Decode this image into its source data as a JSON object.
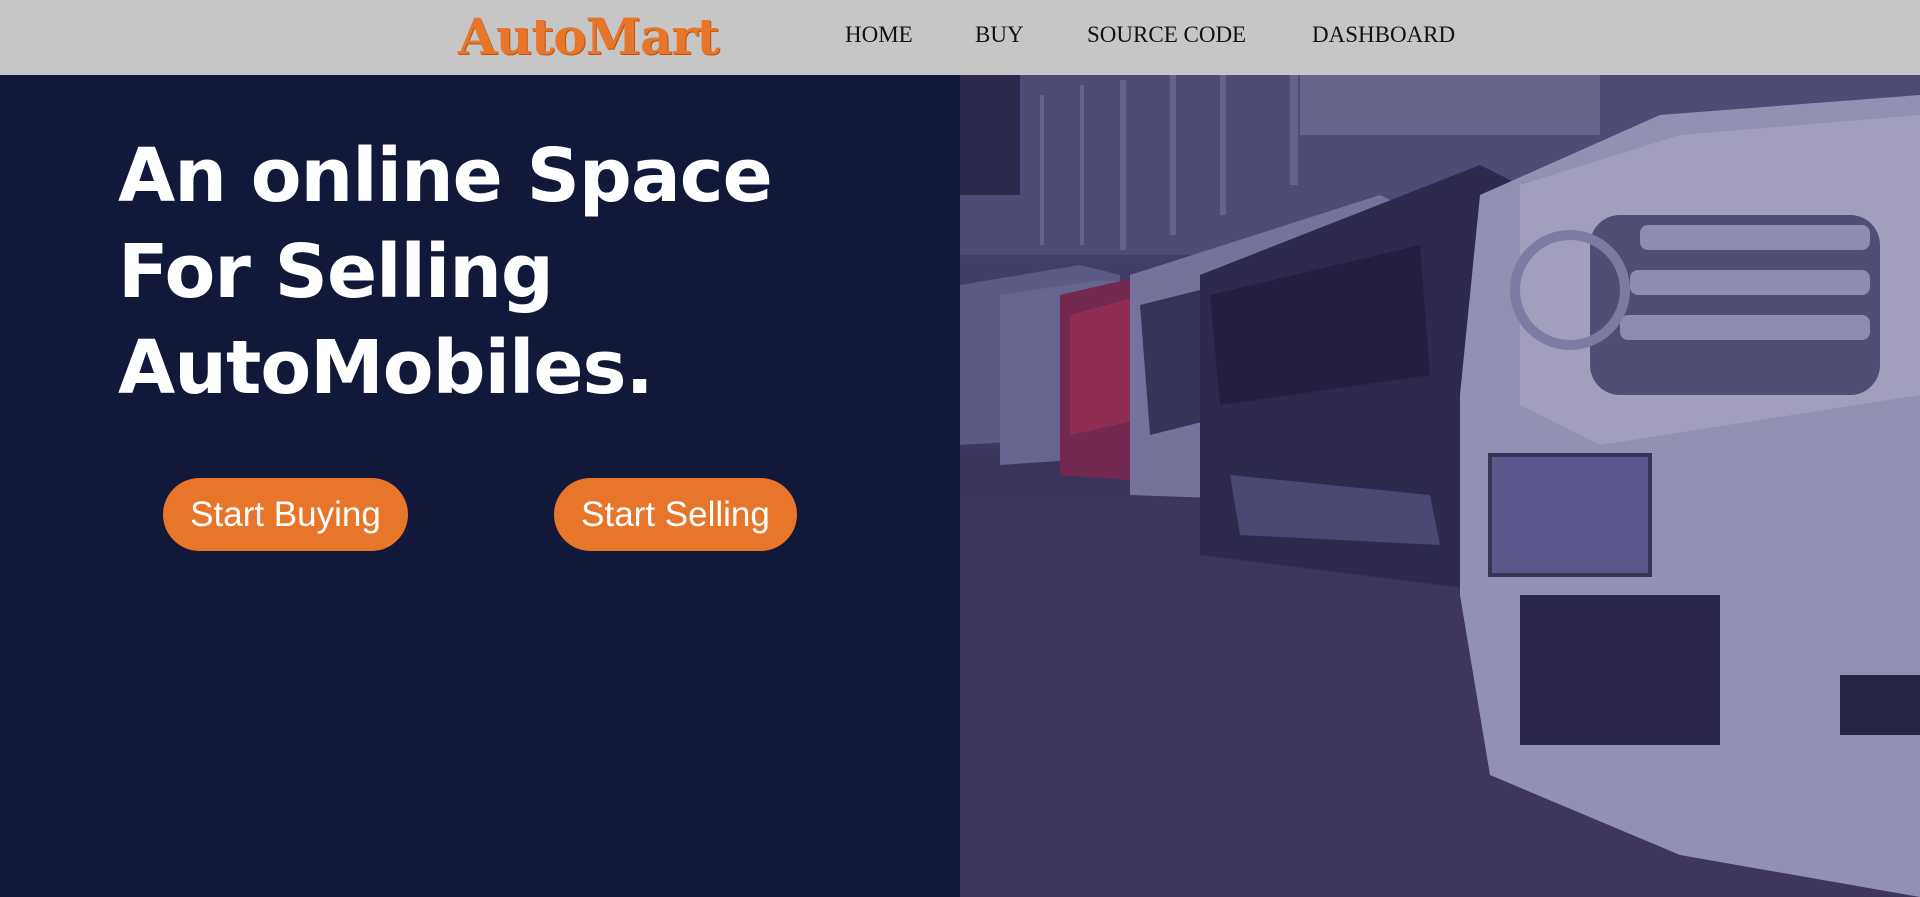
{
  "header": {
    "logo_text": "AutoMart",
    "nav": [
      {
        "label": "HOME"
      },
      {
        "label": "BUY"
      },
      {
        "label": "SOURCE CODE"
      },
      {
        "label": "DASHBOARD"
      }
    ]
  },
  "hero": {
    "headline_lines": [
      "An online Space",
      "For Selling",
      "AutoMobiles."
    ],
    "buttons": {
      "start_buying": "Start Buying",
      "start_selling": "Start Selling"
    },
    "image_subject": "row of parked cars photo"
  },
  "colors": {
    "navbar_bg": "#c6c6c6",
    "hero_bg": "#11183a",
    "accent": "#e8762a",
    "text_light": "#ffffff"
  }
}
